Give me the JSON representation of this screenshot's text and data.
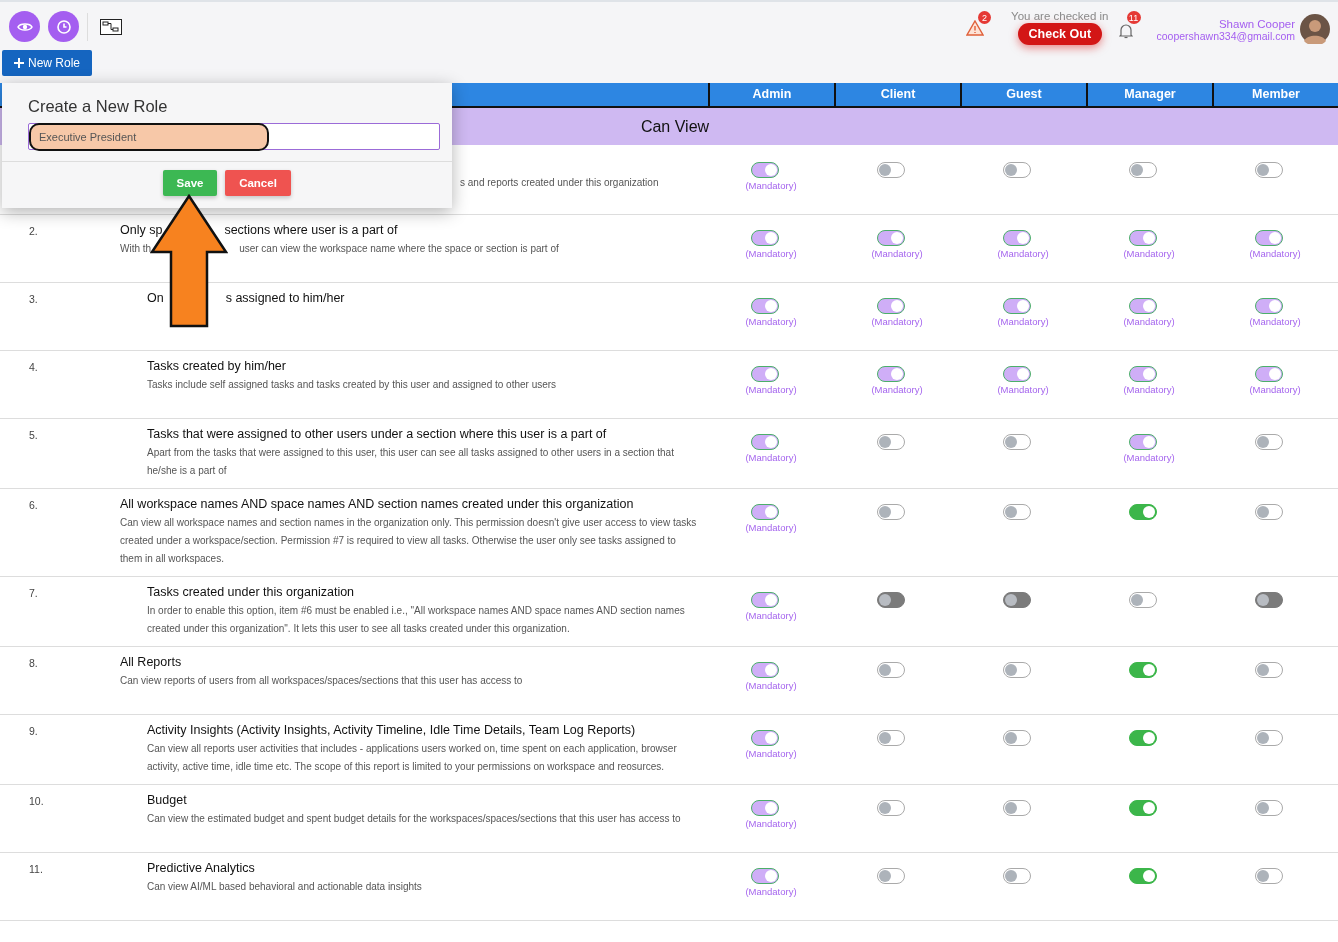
{
  "toolbar": {
    "new_role_button": "New Role"
  },
  "header": {
    "warning_badge": "2",
    "checked_in_text": "You are checked in",
    "check_out_button": "Check Out",
    "notification_badge": "11",
    "user_name": "Shawn Cooper",
    "user_email": "coopershawn334@gmail.com"
  },
  "dialog": {
    "title": "Create a New Role",
    "value": "Executive President",
    "save_button": "Save",
    "cancel_button": "Cancel"
  },
  "table": {
    "columns": [
      "Admin",
      "Client",
      "Guest",
      "Manager",
      "Member"
    ],
    "section": "Can View",
    "rows": [
      {
        "description": [
          "s and reports created under this organization"
        ],
        "toggles": [
          {
            "kind": "mandatory",
            "note": "(Mandatory)"
          },
          {
            "kind": "off"
          },
          {
            "kind": "off"
          },
          {
            "kind": "off"
          },
          {
            "kind": "off"
          }
        ]
      },
      {
        "number": "2.",
        "title": [
          "Only sp",
          "sections where user is a part of"
        ],
        "description": [
          "With th",
          "user can view the workspace name where the space or section is part of"
        ],
        "toggles": [
          {
            "kind": "mandatory",
            "note": "(Mandatory)"
          },
          {
            "kind": "mandatory",
            "note": "(Mandatory)"
          },
          {
            "kind": "mandatory",
            "note": "(Mandatory)"
          },
          {
            "kind": "mandatory",
            "note": "(Mandatory)"
          },
          {
            "kind": "mandatory",
            "note": "(Mandatory)"
          }
        ],
        "children": [
          {
            "number": "3.",
            "title": [
              "On",
              "s assigned to him/her"
            ],
            "toggles": [
              {
                "kind": "mandatory",
                "note": "(Mandatory)"
              },
              {
                "kind": "mandatory",
                "note": "(Mandatory)"
              },
              {
                "kind": "mandatory",
                "note": "(Mandatory)"
              },
              {
                "kind": "mandatory",
                "note": "(Mandatory)"
              },
              {
                "kind": "mandatory",
                "note": "(Mandatory)"
              }
            ]
          },
          {
            "number": "4.",
            "title": [
              "Tasks created by him/her"
            ],
            "description": [
              "Tasks include self assigned tasks and tasks created by this user and assigned to other users"
            ],
            "toggles": [
              {
                "kind": "mandatory",
                "note": "(Mandatory)"
              },
              {
                "kind": "mandatory",
                "note": "(Mandatory)"
              },
              {
                "kind": "mandatory",
                "note": "(Mandatory)"
              },
              {
                "kind": "mandatory",
                "note": "(Mandatory)"
              },
              {
                "kind": "mandatory",
                "note": "(Mandatory)"
              }
            ]
          },
          {
            "number": "5.",
            "title": [
              "Tasks that were assigned to other users under a section where this user is a part of"
            ],
            "description": [
              "Apart from the tasks that were assigned to this user, this user can see all tasks assigned to other users in a section that he/she is a part of"
            ],
            "toggles": [
              {
                "kind": "mandatory",
                "note": "(Mandatory)"
              },
              {
                "kind": "off"
              },
              {
                "kind": "off"
              },
              {
                "kind": "mandatory",
                "note": "(Mandatory)"
              },
              {
                "kind": "off"
              }
            ]
          }
        ]
      },
      {
        "number": "6.",
        "title": [
          "All workspace names AND space names AND section names created under this organization"
        ],
        "description": [
          "Can view all workspace names and section names in the organization only. This permission doesn't give user access to view tasks created under a workspace/section. Permission #7 is required to view all tasks. Otherwise the user only see tasks assigned to them in all workspaces."
        ],
        "toggles": [
          {
            "kind": "mandatory",
            "note": "(Mandatory)"
          },
          {
            "kind": "off"
          },
          {
            "kind": "off"
          },
          {
            "kind": "on"
          },
          {
            "kind": "off"
          }
        ],
        "children": [
          {
            "number": "7.",
            "title": [
              "Tasks created under this organization"
            ],
            "description": [
              "In order to enable this option, item #6 must be enabled i.e., \"All workspace names AND space names AND section names created under this organization\". It lets this user to see all tasks created under this organization."
            ],
            "toggles": [
              {
                "kind": "mandatory",
                "note": "(Mandatory)"
              },
              {
                "kind": "disabled"
              },
              {
                "kind": "disabled"
              },
              {
                "kind": "off"
              },
              {
                "kind": "disabled"
              }
            ]
          }
        ]
      },
      {
        "number": "8.",
        "title": [
          "All Reports"
        ],
        "description": [
          "Can view reports of users from all workspaces/spaces/sections that this user has access to"
        ],
        "toggles": [
          {
            "kind": "mandatory",
            "note": "(Mandatory)"
          },
          {
            "kind": "off"
          },
          {
            "kind": "off"
          },
          {
            "kind": "on"
          },
          {
            "kind": "off"
          }
        ],
        "children": [
          {
            "number": "9.",
            "title": [
              "Activity Insights (Activity Insights, Activity Timeline, Idle Time Details, Team Log Reports)"
            ],
            "description": [
              "Can view all reports user activities that includes - applications users worked on, time spent on each application, browser activity, active time, idle time etc. The scope of this report is limited to your permissions on workspace and reosurces."
            ],
            "toggles": [
              {
                "kind": "mandatory",
                "note": "(Mandatory)"
              },
              {
                "kind": "off"
              },
              {
                "kind": "off"
              },
              {
                "kind": "on"
              },
              {
                "kind": "off"
              }
            ]
          },
          {
            "number": "10.",
            "title": [
              "Budget"
            ],
            "description": [
              "Can view the estimated budget and spent budget details for the workspaces/spaces/sections that this user has access to"
            ],
            "toggles": [
              {
                "kind": "mandatory",
                "note": "(Mandatory)"
              },
              {
                "kind": "off"
              },
              {
                "kind": "off"
              },
              {
                "kind": "on"
              },
              {
                "kind": "off"
              }
            ]
          },
          {
            "number": "11.",
            "title": [
              "Predictive Analytics"
            ],
            "description": [
              "Can view AI/ML based behavioral and actionable data insights"
            ],
            "toggles": [
              {
                "kind": "mandatory",
                "note": "(Mandatory)"
              },
              {
                "kind": "off"
              },
              {
                "kind": "off"
              },
              {
                "kind": "on"
              },
              {
                "kind": "off"
              }
            ]
          }
        ]
      }
    ]
  }
}
